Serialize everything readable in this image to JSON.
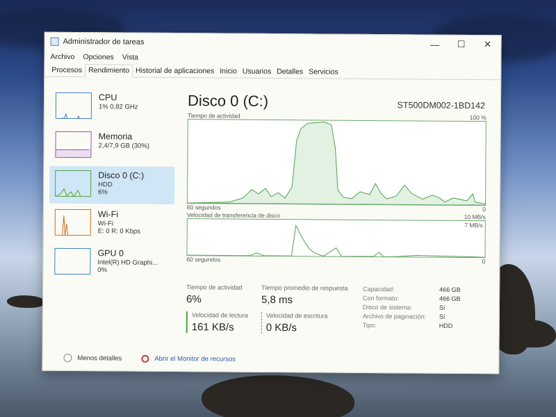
{
  "window": {
    "title": "Administrador de tareas",
    "controls": {
      "minimize": "—",
      "maximize": "☐",
      "close": "✕"
    }
  },
  "menu": [
    "Archivo",
    "Opciones",
    "Vista"
  ],
  "tabs": [
    {
      "label": "Procesos",
      "active": false
    },
    {
      "label": "Rendimiento",
      "active": true
    },
    {
      "label": "Historial de aplicaciones",
      "active": false
    },
    {
      "label": "Inicio",
      "active": false
    },
    {
      "label": "Usuarios",
      "active": false
    },
    {
      "label": "Detalles",
      "active": false
    },
    {
      "label": "Servicios",
      "active": false
    }
  ],
  "sidebar": [
    {
      "name": "CPU",
      "line1": "1% 0,82 GHz",
      "line2": "",
      "line3": "",
      "color": "#3d7fc1",
      "selected": false
    },
    {
      "name": "Memoria",
      "line1": "2,4/7,9 GB (30%)",
      "line2": "",
      "line3": "",
      "color": "#9b4fb0",
      "selected": false
    },
    {
      "name": "Disco 0 (C:)",
      "line1": "HDD",
      "line2": "6%",
      "line3": "",
      "color": "#4ea04e",
      "selected": true
    },
    {
      "name": "Wi-Fi",
      "line1": "Wi-Fi",
      "line2": "E: 0 R: 0 Kbps",
      "line3": "",
      "color": "#c8701e",
      "selected": false
    },
    {
      "name": "GPU 0",
      "line1": "Intel(R) HD Graphi...",
      "line2": "0%",
      "line3": "",
      "color": "#3d7fc1",
      "selected": false
    }
  ],
  "main": {
    "title": "Disco 0 (C:)",
    "model": "ST500DM002-1BD142",
    "graph1": {
      "label": "Tiempo de actividad",
      "max": "100 %",
      "time": "60 segundos",
      "zero": "0"
    },
    "graph2": {
      "label": "Velocidad de transferencia de disco",
      "max": "10 MB/s",
      "sub": "7 MB/s",
      "time": "60 segundos",
      "zero": "0"
    }
  },
  "stats": {
    "activity_label": "Tiempo de actividad",
    "activity_value": "6%",
    "response_label": "Tiempo promedio de respuesta",
    "response_value": "5,8 ms",
    "read_label": "Velocidad de lectura",
    "read_value": "161 KB/s",
    "write_label": "Velocidad de escritura",
    "write_value": "0 KB/s"
  },
  "properties": [
    {
      "key": "Capacidad:",
      "value": "466 GB"
    },
    {
      "key": "Con formato:",
      "value": "466 GB"
    },
    {
      "key": "Disco de sistema:",
      "value": "Sí"
    },
    {
      "key": "Archivo de paginación:",
      "value": "Sí"
    },
    {
      "key": "Tipo:",
      "value": "HDD"
    }
  ],
  "footer": {
    "less_details": "Menos detalles",
    "open_monitor": "Abrir el Monitor de recursos"
  }
}
